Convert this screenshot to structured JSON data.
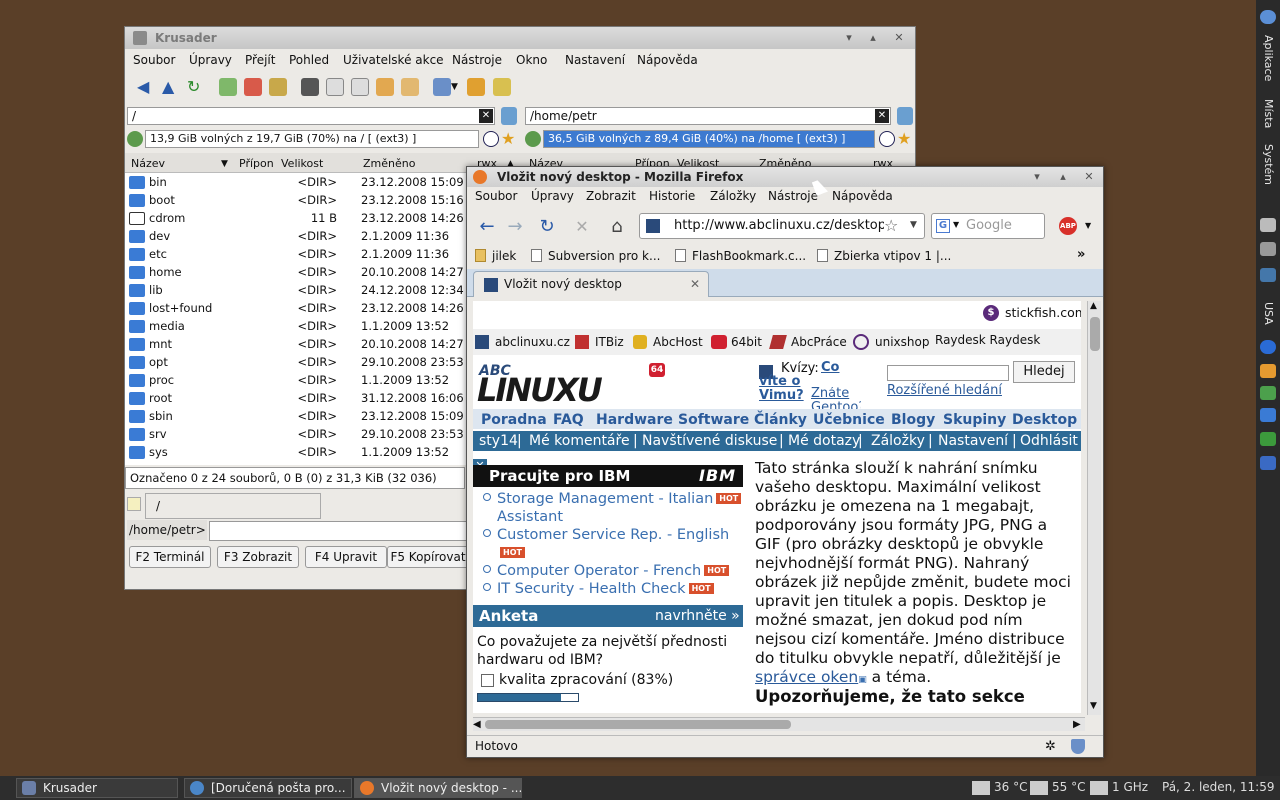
{
  "right_panel": {
    "labels": [
      "Aplikace",
      "Místa",
      "Systém",
      "USA"
    ]
  },
  "taskbar": {
    "tasks": [
      "Krusader",
      "[Doručená pošta pro...",
      "Vložit nový desktop - ..."
    ],
    "temp1": "36 °C",
    "temp2": "55 °C",
    "cpu": "1 GHz",
    "clock": "Pá,  2. leden, 11:59"
  },
  "krusader": {
    "title": "Krusader",
    "menu": [
      "Soubor",
      "Úpravy",
      "Přejít",
      "Pohled",
      "Uživatelské akce",
      "Nástroje",
      "Okno",
      "Nastavení",
      "Nápověda"
    ],
    "left_path": "/",
    "right_path": "/home/petr",
    "left_free": "13,9 GiB volných z 19,7 GiB (70%) na / [ (ext3) ]",
    "right_free": "36,5 GiB volných z 89,4 GiB (40%) na /home [ (ext3) ]",
    "columns": {
      "name": "Název",
      "ext": "Přípon",
      "size": "Velikost",
      "modified": "Změněno",
      "perm": "rwx"
    },
    "files": [
      {
        "name": "bin",
        "size": "<DIR>",
        "date": "23.12.2008 15:09"
      },
      {
        "name": "boot",
        "size": "<DIR>",
        "date": "23.12.2008 15:16"
      },
      {
        "name": "cdrom",
        "size": "11 B",
        "date": "23.12.2008 14:26"
      },
      {
        "name": "dev",
        "size": "<DIR>",
        "date": "2.1.2009 11:36"
      },
      {
        "name": "etc",
        "size": "<DIR>",
        "date": "2.1.2009 11:36"
      },
      {
        "name": "home",
        "size": "<DIR>",
        "date": "20.10.2008 14:27"
      },
      {
        "name": "lib",
        "size": "<DIR>",
        "date": "24.12.2008 12:34"
      },
      {
        "name": "lost+found",
        "size": "<DIR>",
        "date": "23.12.2008 14:26"
      },
      {
        "name": "media",
        "size": "<DIR>",
        "date": "1.1.2009 13:52"
      },
      {
        "name": "mnt",
        "size": "<DIR>",
        "date": "20.10.2008 14:27"
      },
      {
        "name": "opt",
        "size": "<DIR>",
        "date": "29.10.2008 23:53"
      },
      {
        "name": "proc",
        "size": "<DIR>",
        "date": "1.1.2009 13:52"
      },
      {
        "name": "root",
        "size": "<DIR>",
        "date": "31.12.2008 16:06"
      },
      {
        "name": "sbin",
        "size": "<DIR>",
        "date": "23.12.2008 15:09"
      },
      {
        "name": "srv",
        "size": "<DIR>",
        "date": "29.10.2008 23:53"
      },
      {
        "name": "sys",
        "size": "<DIR>",
        "date": "1.1.2009 13:52"
      }
    ],
    "status": "Označeno 0 z 24 souborů, 0 B  (0) z 31,3 KiB (32 036)",
    "tab": "/",
    "cmd_prompt": "/home/petr>",
    "fkeys": [
      "F2 Terminál",
      "F3 Zobrazit",
      "F4 Upravit",
      "F5 Kopírovat"
    ]
  },
  "firefox": {
    "title": "Vložit nový desktop - Mozilla Firefox",
    "menu": [
      "Soubor",
      "Úpravy",
      "Zobrazit",
      "Historie",
      "Záložky",
      "Nástroje",
      "Nápověda"
    ],
    "url": "http://www.abclinuxu.cz/desktopy",
    "search_placeholder": "Google",
    "bookmarks": [
      "jilek",
      "Subversion pro k...",
      "FlashBookmark.c...",
      "Zbierka vtipov 1 |..."
    ],
    "tab": "Vložit nový desktop",
    "status": "Hotovo",
    "page": {
      "stickfish": "stickfish.com",
      "portal_links": [
        "abclinuxu.cz",
        "ITBiz",
        "AbcHost",
        "64bit",
        "AbcPráce",
        "unixshop",
        "Raydesk Raydesk"
      ],
      "badge64": "64",
      "kvizy": "Kvízy:",
      "kvizy_link": "Co víte o Vimu?",
      "znate": "Znáte Gentoo? Co",
      "search_button": "Hledej",
      "advanced_search": "Rozšířené hledání",
      "nav": [
        "Poradna",
        "FAQ",
        "Hardware",
        "Software",
        "Články",
        "Učebnice",
        "Blogy",
        "Skupiny",
        "Desktop"
      ],
      "subnav": [
        "sty14",
        "Mé komentáře",
        "Navštívené diskuse",
        "Mé dotazy",
        "Záložky",
        "Nastavení",
        "Odhlásit"
      ],
      "ibm_title": "Pracujte pro IBM",
      "ibm_logo": "IBM",
      "jobs": [
        "Storage Management - Italian",
        "Assistant",
        "Customer Service Rep. - English",
        "Computer Operator - French",
        "IT Security - Health Check"
      ],
      "hot": "HOT",
      "anketa": "Anketa",
      "navrhnete": "navrhněte »",
      "poll_question": "Co považujete za největší přednosti hardwaru od IBM?",
      "poll_option": "kvalita zpracování (83%)",
      "poll_value": 83,
      "text": "Tato stránka slouží k nahrání snímku vašeho desktopu. Maximální velikost obrázku je omezena na 1 megabajt, podporovány jsou formáty JPG, PNG a GIF (pro obrázky desktopů je obvykle nejvhodnější formát PNG). Nahraný obrázek již nepůjde změnit, budete moci upravit jen titulek a popis. Desktop je možné smazat, jen dokud pod ním nejsou cizí komentáře. Jméno distribuce do titulku obvykle nepatří, důležitější je",
      "text_link": "správce oken",
      "text_end": " a téma.",
      "warning": "Upozorňujeme, že tato sekce"
    }
  }
}
